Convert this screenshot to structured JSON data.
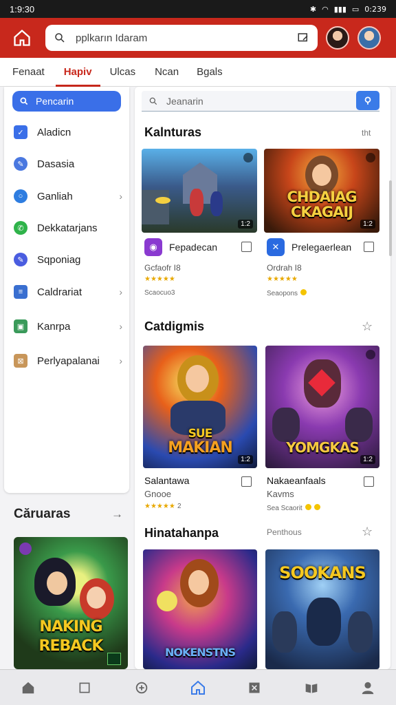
{
  "status": {
    "time": "1:9:30",
    "battery": "0:239"
  },
  "header": {
    "search_value": "pplkarın Idaram"
  },
  "tabs": [
    {
      "label": "Fenaat"
    },
    {
      "label": "Hapiv"
    },
    {
      "label": "Ulcas"
    },
    {
      "label": "Ncan"
    },
    {
      "label": "Bgals"
    }
  ],
  "sidebar": {
    "search_label": "Pencarin",
    "items": [
      {
        "label": "Aladicn"
      },
      {
        "label": "Dasasia"
      },
      {
        "label": "Ganliah"
      },
      {
        "label": "Dekkatarjans"
      },
      {
        "label": "Sqponiag"
      },
      {
        "label": "Caldrariat"
      },
      {
        "label": "Kanrpa"
      },
      {
        "label": "Perlyapalanai"
      }
    ]
  },
  "lower": {
    "title": "Căruaras",
    "card_text_1": "NAKING",
    "card_text_2": "REBACK"
  },
  "main": {
    "search_placeholder": "Jeanarin",
    "section1": {
      "title": "Kalnturas",
      "right": "tht",
      "cards": [
        {
          "badge": "1:2",
          "app_name": "Fepadecan",
          "sub": "Gcfaofr I8",
          "stars": "★★★★★",
          "meta": "Scaocuo3"
        },
        {
          "badge": "1:2",
          "art_text_1": "CHDAIAG",
          "art_text_2": "CKAGAIJ",
          "app_name": "Prelegaerlean",
          "sub": "Ordrah I8",
          "stars": "★★★★★",
          "meta": "Seaopons"
        }
      ]
    },
    "section2": {
      "title": "Catdigmis",
      "cards": [
        {
          "badge": "1:2",
          "art_text_1": "SUE",
          "art_text_2": "MAKIAN",
          "title": "Salantawa",
          "sub": "Gnooe",
          "stars": "★★★★★",
          "meta": "2"
        },
        {
          "badge": "1:2",
          "art_text_1": "YOMGKAS",
          "title": "Nakaeanfaals",
          "sub": "Kavms",
          "meta": "Sea Scaorit"
        }
      ]
    },
    "section3": {
      "title": "Hinatahanpa",
      "right": "Penthous",
      "cards": [
        {
          "art_text_1": "NOKENSTNS"
        },
        {
          "art_text_1": "SOOKANS"
        }
      ]
    }
  }
}
